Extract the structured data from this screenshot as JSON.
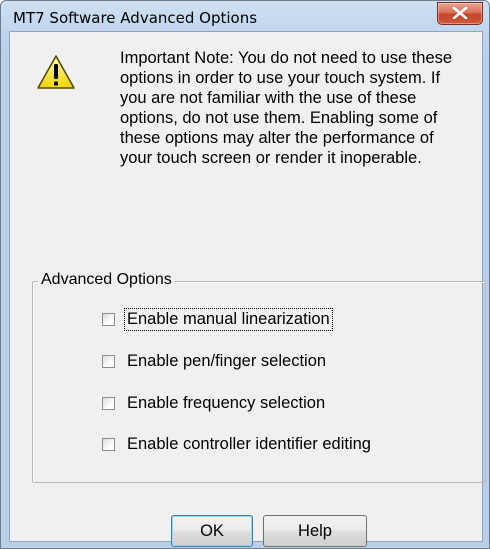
{
  "window": {
    "title": "MT7 Software Advanced Options",
    "close_icon": "close-x-icon"
  },
  "note": {
    "icon": "warning-icon",
    "text": "Important Note: You do not need to use these options in order to use your touch system. If you are not familiar with the use of these options, do not use them. Enabling some of these options may alter the performance of your touch screen or render it inoperable."
  },
  "advanced_options": {
    "legend": "Advanced Options",
    "options": [
      {
        "label": "Enable manual linearization",
        "checked": false
      },
      {
        "label": "Enable pen/finger selection",
        "checked": false
      },
      {
        "label": "Enable frequency selection",
        "checked": false
      },
      {
        "label": "Enable controller identifier editing",
        "checked": false
      }
    ]
  },
  "buttons": {
    "ok_label": "OK",
    "help_label": "Help"
  },
  "colors": {
    "titlebar": "#bcd3ec",
    "close_button": "#c54326",
    "dialog_face": "#f0f0f0"
  }
}
